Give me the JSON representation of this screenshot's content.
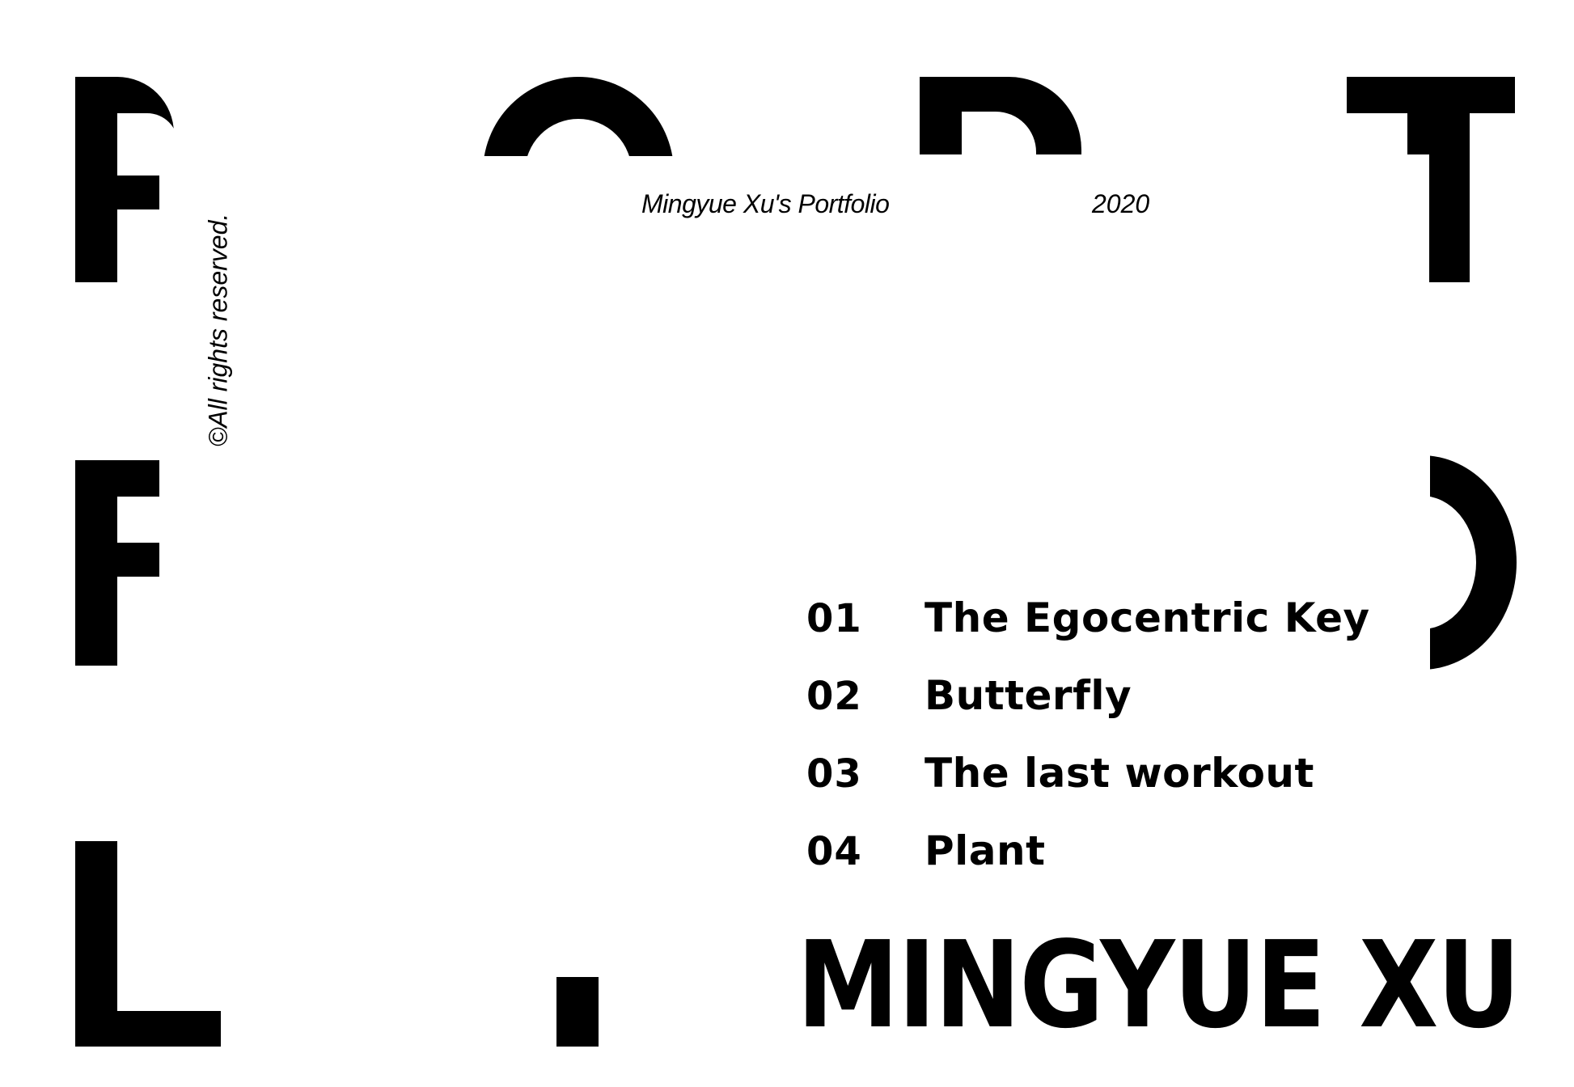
{
  "header": {
    "title": "Mingyue Xu's Portfolio",
    "year": "2020"
  },
  "copyright": "©All rights reserved.",
  "toc": [
    {
      "number": "01",
      "title": "The Egocentric Key"
    },
    {
      "number": "02",
      "title": "Butterfly"
    },
    {
      "number": "03",
      "title": "The last workout"
    },
    {
      "number": "04",
      "title": "Plant"
    }
  ],
  "author_name": "MINGYUE XU",
  "decorative_letters": [
    "P",
    "O",
    "R",
    "T",
    "F",
    ")",
    "L",
    "."
  ],
  "colors": {
    "ink": "#000000",
    "paper": "#ffffff"
  }
}
